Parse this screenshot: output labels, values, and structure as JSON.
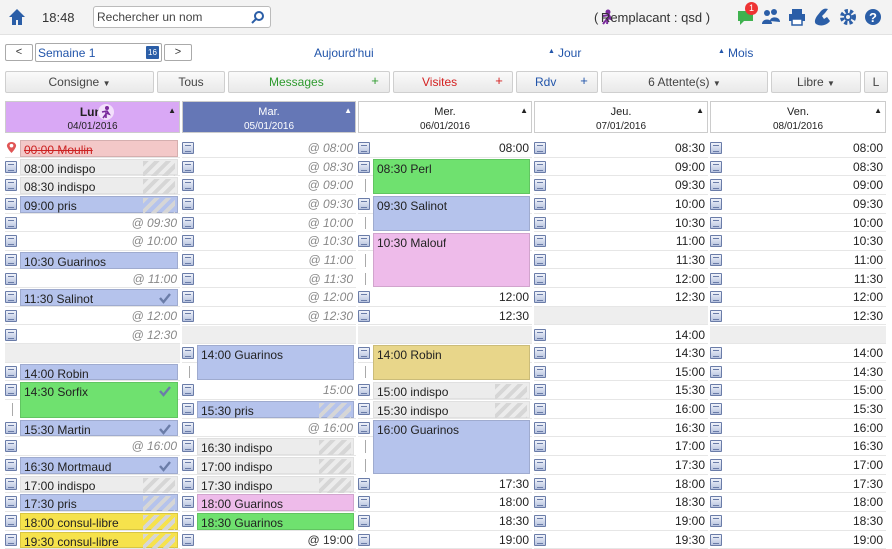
{
  "header": {
    "time": "18:48",
    "search_placeholder": "Rechercher un nom",
    "replacement": "( Remplacant : qsd )",
    "badge": "1"
  },
  "nav": {
    "prev": "<",
    "next": ">",
    "week": "Semaine 1",
    "today": "Aujourd'hui",
    "day": "Jour",
    "month": "Mois"
  },
  "filters": {
    "consigne": "Consigne",
    "tous": "Tous",
    "messages": "Messages",
    "visites": "Visites",
    "rdv": "Rdv",
    "attente": "6 Attente(s)",
    "libre": "Libre",
    "l": "L",
    "plus": "+"
  },
  "colors": {
    "lun": "#d9a8f5",
    "mar": "#6577b6",
    "green": "#6fe16f",
    "blue": "#b5c3ec",
    "pink": "#eebbea",
    "yellow": "#f6e24c",
    "gold": "#e8d68a",
    "red_bg": "#f3c8c8",
    "indispo": "#ececec"
  },
  "days": [
    {
      "name": "Lun.",
      "date": "04/01/2016"
    },
    {
      "name": "Mar.",
      "date": "05/01/2016"
    },
    {
      "name": "Mer.",
      "date": "06/01/2016"
    },
    {
      "name": "Jeu.",
      "date": "07/01/2016"
    },
    {
      "name": "Ven.",
      "date": "08/01/2016"
    }
  ],
  "lun": [
    {
      "t": "00:00 Moulin",
      "type": "moulin"
    },
    {
      "t": "08:00 indispo",
      "type": "indispo"
    },
    {
      "t": "08:30 indispo",
      "type": "indispo"
    },
    {
      "t": "09:00 pris",
      "type": "pris"
    },
    {
      "t": "@ 09:30",
      "type": "free"
    },
    {
      "t": "@ 10:00",
      "type": "free"
    },
    {
      "t": "10:30 Guarinos",
      "type": "blue"
    },
    {
      "t": "@ 11:00",
      "type": "free"
    },
    {
      "t": "11:30 Salinot",
      "type": "bluecheck"
    },
    {
      "t": "@ 12:00",
      "type": "free"
    },
    {
      "t": "@ 12:30",
      "type": "free"
    },
    {
      "t": "",
      "type": "gap"
    },
    {
      "t": "14:00 Robin",
      "type": "blue"
    },
    {
      "t": "14:30 Sorfix",
      "type": "greencheck2"
    },
    {
      "t": "",
      "type": "skip"
    },
    {
      "t": "15:30 Martin",
      "type": "bluecheck"
    },
    {
      "t": "@ 16:00",
      "type": "free"
    },
    {
      "t": "16:30 Mortmaud",
      "type": "bluecheck"
    },
    {
      "t": "17:00 indispo",
      "type": "indispo"
    },
    {
      "t": "17:30 pris",
      "type": "pris"
    },
    {
      "t": "18:00 consul-libre",
      "type": "yellow"
    },
    {
      "t": "19:30 consul-libre",
      "type": "yellow"
    }
  ],
  "mar": [
    {
      "t": "@ 08:00",
      "type": "free"
    },
    {
      "t": "@ 08:30",
      "type": "free"
    },
    {
      "t": "@ 09:00",
      "type": "free"
    },
    {
      "t": "@ 09:30",
      "type": "free"
    },
    {
      "t": "@ 10:00",
      "type": "free"
    },
    {
      "t": "@ 10:30",
      "type": "free"
    },
    {
      "t": "@ 11:00",
      "type": "free"
    },
    {
      "t": "@ 11:30",
      "type": "free"
    },
    {
      "t": "@ 12:00",
      "type": "free"
    },
    {
      "t": "@ 12:30",
      "type": "free"
    },
    {
      "t": "",
      "type": "gap"
    },
    {
      "t": "14:00 Guarinos",
      "type": "blue2"
    },
    {
      "t": "",
      "type": "skip"
    },
    {
      "t": "15:00",
      "type": "freeplain"
    },
    {
      "t": "15:30 pris",
      "type": "pris"
    },
    {
      "t": "@ 16:00",
      "type": "free"
    },
    {
      "t": "16:30 indispo",
      "type": "indispo"
    },
    {
      "t": "17:00 indispo",
      "type": "indispo"
    },
    {
      "t": "17:30 indispo",
      "type": "indispo"
    },
    {
      "t": "18:00 Guarinos",
      "type": "pink"
    },
    {
      "t": "18:30 Guarinos",
      "type": "green"
    },
    {
      "t": "@ 19:00",
      "type": "freedark"
    }
  ],
  "mer": [
    {
      "t": "08:00",
      "type": "time"
    },
    {
      "t": "08:30 Perl",
      "type": "green2"
    },
    {
      "t": "",
      "type": "skip"
    },
    {
      "t": "09:30 Salinot",
      "type": "blue2"
    },
    {
      "t": "",
      "type": "skip"
    },
    {
      "t": "10:30 Malouf",
      "type": "pink3"
    },
    {
      "t": "",
      "type": "skip"
    },
    {
      "t": "",
      "type": "skip"
    },
    {
      "t": "12:00",
      "type": "time"
    },
    {
      "t": "12:30",
      "type": "time"
    },
    {
      "t": "",
      "type": "gap"
    },
    {
      "t": "14:00 Robin",
      "type": "gold2"
    },
    {
      "t": "",
      "type": "skip"
    },
    {
      "t": "15:00 indispo",
      "type": "indispo"
    },
    {
      "t": "15:30 indispo",
      "type": "indispo"
    },
    {
      "t": "16:00 Guarinos",
      "type": "blue3"
    },
    {
      "t": "",
      "type": "skip"
    },
    {
      "t": "",
      "type": "skip"
    },
    {
      "t": "17:30",
      "type": "time"
    },
    {
      "t": "18:00",
      "type": "time"
    },
    {
      "t": "18:30",
      "type": "time"
    },
    {
      "t": "19:00",
      "type": "time"
    }
  ],
  "jeu": [
    "08:30",
    "09:00",
    "09:30",
    "10:00",
    "10:30",
    "11:00",
    "11:30",
    "12:00",
    "12:30",
    "",
    "14:00",
    "14:30",
    "15:00",
    "15:30",
    "16:00",
    "16:30",
    "17:00",
    "17:30",
    "18:00",
    "18:30",
    "19:00",
    "19:30"
  ],
  "ven": [
    "08:00",
    "08:30",
    "09:00",
    "09:30",
    "10:00",
    "10:30",
    "11:00",
    "11:30",
    "12:00",
    "12:30",
    "",
    "14:00",
    "14:30",
    "15:00",
    "15:30",
    "16:00",
    "16:30",
    "17:00",
    "17:30",
    "18:00",
    "18:30",
    "19:00"
  ]
}
